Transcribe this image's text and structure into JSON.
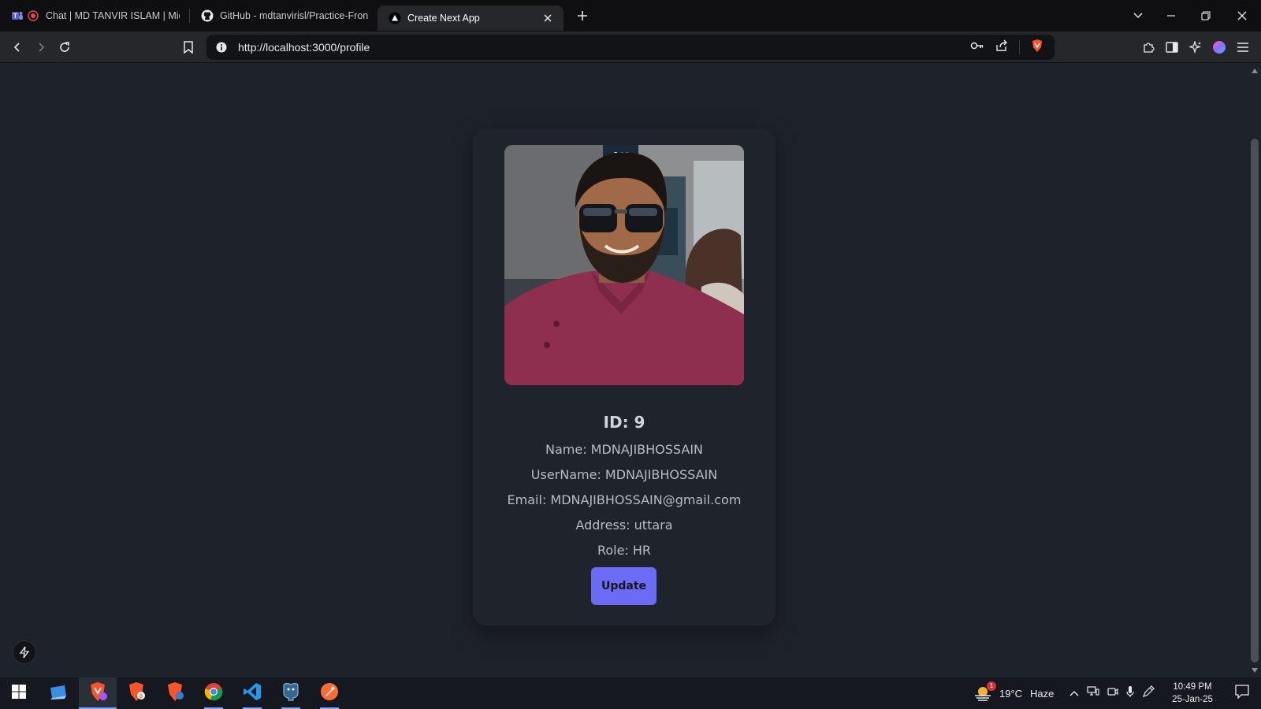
{
  "browser": {
    "tabs": [
      {
        "title": "Chat | MD TANVIR ISLAM | Micr",
        "icon": "teams-icon",
        "active": false
      },
      {
        "title": "GitHub - mdtanvirisl/Practice-Fronte",
        "icon": "github-icon",
        "active": false
      },
      {
        "title": "Create Next App",
        "icon": "nextjs-triangle-icon",
        "active": true
      }
    ],
    "url": "http://localhost:3000/profile"
  },
  "profile": {
    "id_text": "ID: 9",
    "name_text": "Name: MDNAJIBHOSSAIN",
    "username_text": "UserName: MDNAJIBHOSSAIN",
    "email_text": "Email: MDNAJIBHOSSAIN@gmail.com",
    "address_text": "Address: uttara",
    "role_text": "Role: HR",
    "update_label": "Update",
    "photo_alt": "profile-photo"
  },
  "taskbar": {
    "apps": [
      "start-icon",
      "file-explorer-icon",
      "brave-icon",
      "brave-beta-icon",
      "brave-nightly-icon",
      "chrome-icon",
      "vscode-icon",
      "pgadmin-icon",
      "postman-icon"
    ],
    "weather": {
      "badge": "1",
      "temp": "19°C",
      "condition": "Haze"
    },
    "time": "10:49 PM",
    "date": "25-Jan-25"
  },
  "colors": {
    "page_bg": "#1e222b",
    "button": "#6b6bf5",
    "text": "#b8bcc4"
  }
}
